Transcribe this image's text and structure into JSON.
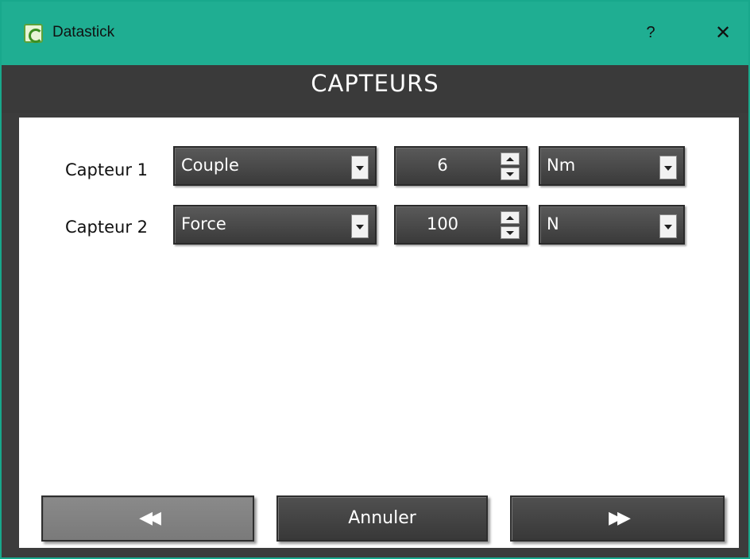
{
  "window": {
    "title": "Datastick",
    "help_label": "?",
    "close_label": "✕",
    "accent_color": "#1fae92"
  },
  "header": {
    "title": "CAPTEURS"
  },
  "sensors": [
    {
      "label": "Capteur 1",
      "type": "Couple",
      "value": "6",
      "unit": "Nm"
    },
    {
      "label": "Capteur 2",
      "type": "Force",
      "value": "100",
      "unit": "N"
    }
  ],
  "buttons": {
    "previous_glyph": "◀◀",
    "cancel_label": "Annuler",
    "next_glyph": "▶▶"
  }
}
